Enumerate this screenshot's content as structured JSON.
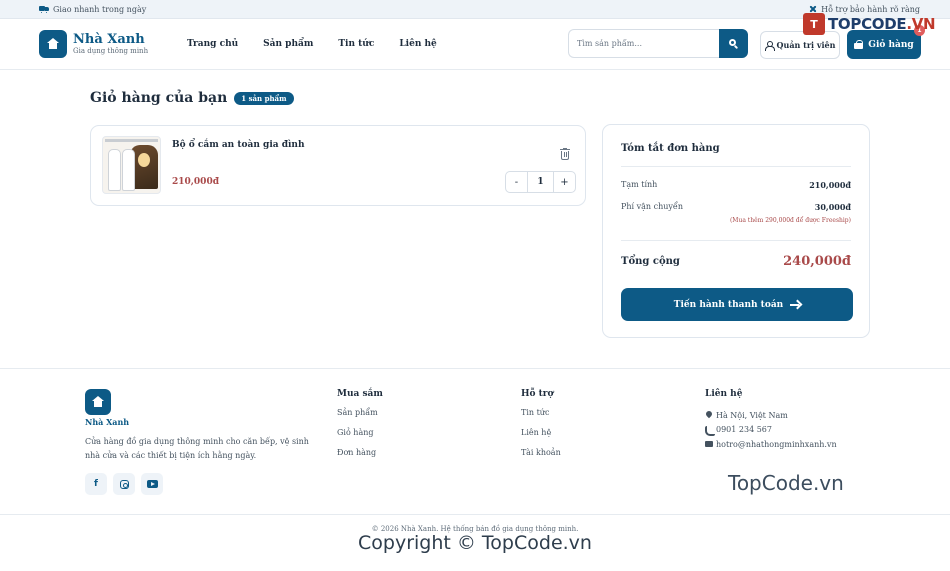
{
  "topbar": {
    "left_text": "Giao nhanh trong ngày",
    "right_text": "Hỗ trợ bảo hành rõ ràng"
  },
  "header": {
    "logo_name": "Nhà Xanh",
    "logo_tagline": "Gia dụng thông minh",
    "nav": [
      "Trang chủ",
      "Sản phẩm",
      "Tin tức",
      "Liên hệ"
    ],
    "search_placeholder": "Tìm sản phẩm...",
    "admin_label": "Quản trị viên",
    "cart_label": "Giỏ hàng",
    "cart_count": "1"
  },
  "watermark_logo": {
    "mark": "T",
    "text": "TOPCODE",
    "suffix": ".VN"
  },
  "cart": {
    "title": "Giỏ hàng của bạn",
    "badge": "1 sản phẩm",
    "items": [
      {
        "name": "Bộ ổ cắm an toàn gia đình",
        "price": "210,000đ",
        "qty": "1",
        "minus": "-",
        "plus": "+"
      }
    ]
  },
  "summary": {
    "title": "Tóm tắt đơn hàng",
    "subtotal_label": "Tạm tính",
    "subtotal_value": "210,000đ",
    "shipping_label": "Phí vận chuyển",
    "shipping_value": "30,000đ",
    "shipping_note": "(Mua thêm 290,000đ để được Freeship)",
    "total_label": "Tổng cộng",
    "total_value": "240,000đ",
    "checkout_label": "Tiến hành thanh toán"
  },
  "footer": {
    "brand_name": "Nhà Xanh",
    "description": "Cửa hàng đồ gia dụng thông minh cho căn bếp, vệ sinh nhà cửa và các thiết bị tiện ích hằng ngày.",
    "social": {
      "facebook": "f"
    },
    "col_shop": {
      "title": "Mua sắm",
      "links": [
        "Sản phẩm",
        "Giỏ hàng",
        "Đơn hàng"
      ]
    },
    "col_support": {
      "title": "Hỗ trợ",
      "links": [
        "Tin tức",
        "Liên hệ",
        "Tài khoản"
      ]
    },
    "col_contact": {
      "title": "Liên hệ",
      "address": "Hà Nội, Việt Nam",
      "phone": "0901 234 567",
      "email": "hotro@nhathongminhxanh.vn"
    },
    "copyright": "© 2026 Nhà Xanh. Hệ thống bán đồ gia dụng thông minh.",
    "watermark_text": "TopCode.vn",
    "watermark_copy": "Copyright © TopCode.vn"
  },
  "icons": [
    "truck-icon",
    "wrench-icon",
    "house-icon",
    "search-icon",
    "user-icon",
    "bag-icon",
    "trash-icon",
    "arrow-right-icon",
    "facebook-icon",
    "instagram-icon",
    "youtube-icon",
    "map-pin-icon",
    "phone-icon",
    "mail-icon"
  ],
  "colors": {
    "primary": "#0d5a86",
    "price": "#a94a4a",
    "badge_alert": "#e05d5d"
  }
}
